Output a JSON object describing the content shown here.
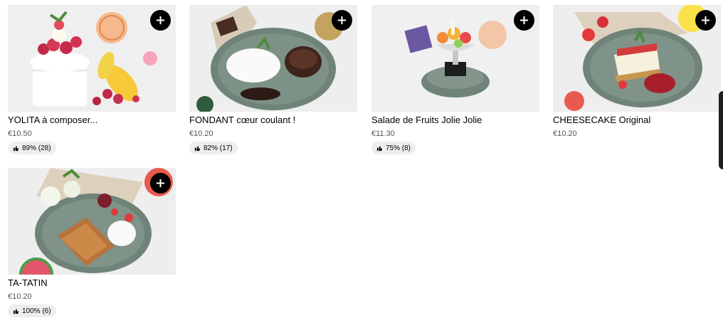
{
  "items": [
    {
      "name": "YOLITA à composer...",
      "price": "€10.50",
      "rating": "89% (28)",
      "image_icon": "frozen-yogurt-photo",
      "add_icon": "plus-icon"
    },
    {
      "name": "FONDANT cœur coulant !",
      "price": "€10.20",
      "rating": "82% (17)",
      "image_icon": "chocolate-fondant-photo",
      "add_icon": "plus-icon"
    },
    {
      "name": "Salade de Fruits Jolie Jolie",
      "price": "€11.30",
      "rating": "75% (8)",
      "image_icon": "fruit-salad-photo",
      "add_icon": "plus-icon"
    },
    {
      "name": "CHEESECAKE Original",
      "price": "€10.20",
      "rating": "",
      "image_icon": "cheesecake-photo",
      "add_icon": "plus-icon"
    },
    {
      "name": "TA-TATIN",
      "price": "€10.20",
      "rating": "100% (6)",
      "image_icon": "tarte-tatin-photo",
      "add_icon": "plus-icon"
    }
  ],
  "colors": {
    "button": "#000000",
    "badge_bg": "#eeeeee",
    "price_text": "#545454",
    "plate": "#6f8378",
    "photo_bg": "#eeeeee"
  }
}
